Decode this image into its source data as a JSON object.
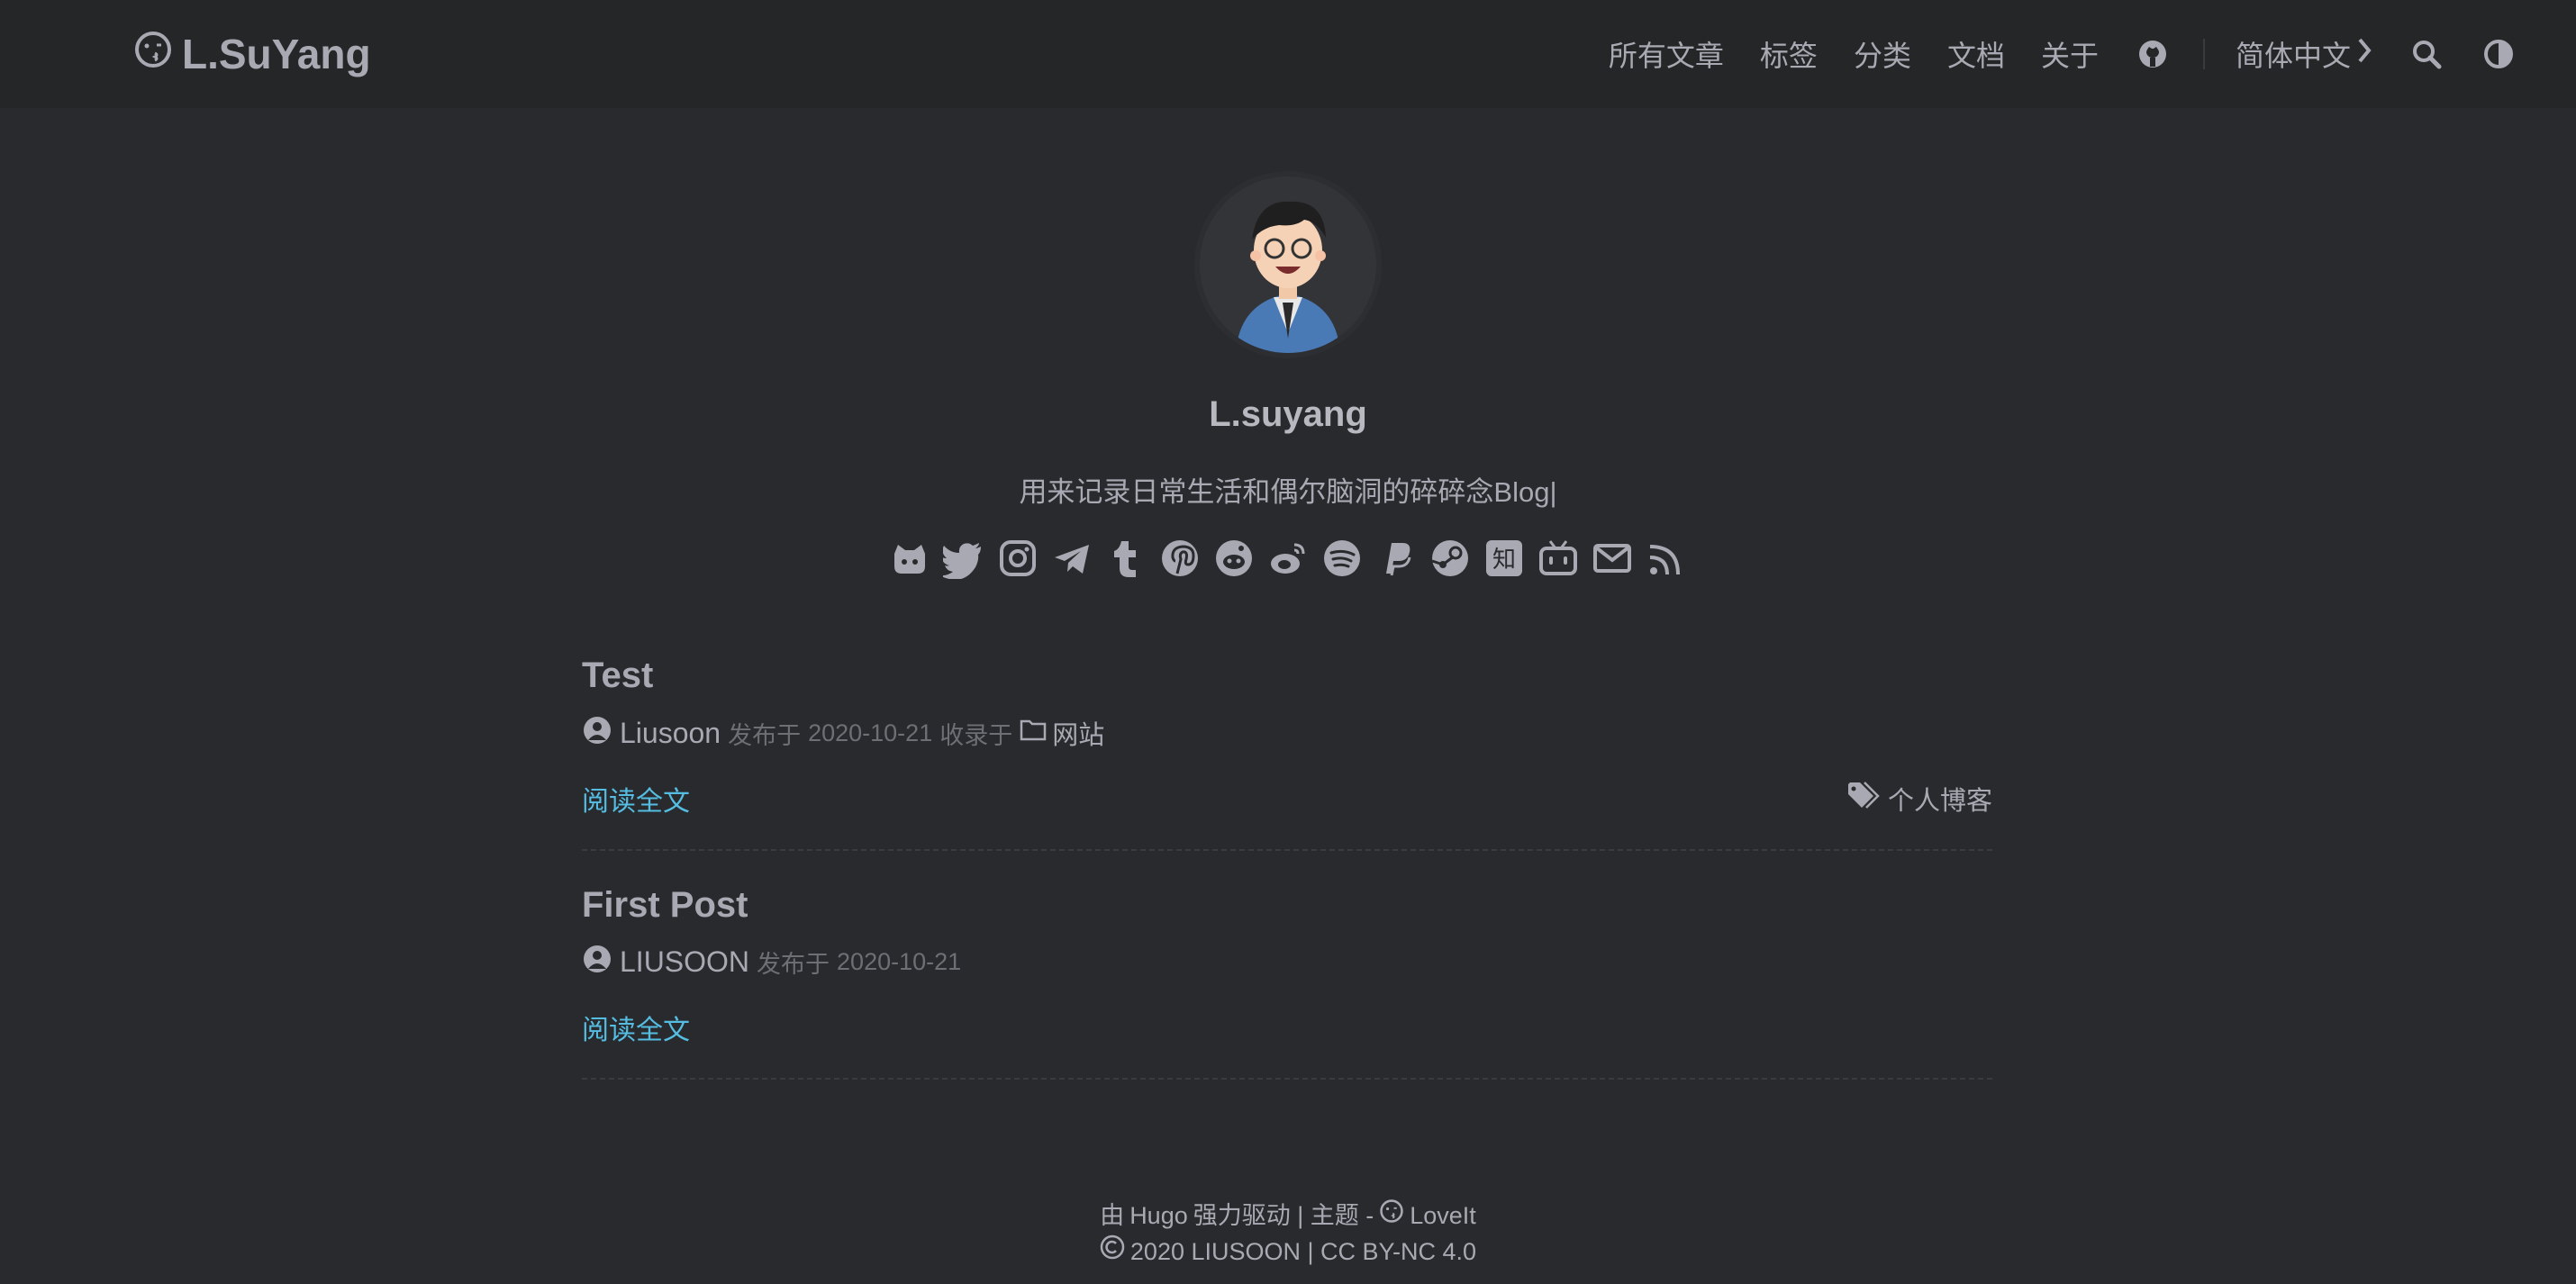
{
  "header": {
    "logo_text": "L.SuYang",
    "nav": [
      "所有文章",
      "标签",
      "分类",
      "文档",
      "关于"
    ],
    "language": "简体中文"
  },
  "profile": {
    "name": "L.suyang",
    "subtitle": "用来记录日常生活和偶尔脑洞的碎碎念Blog|",
    "socials": [
      "github-icon",
      "twitter-icon",
      "instagram-icon",
      "telegram-icon",
      "tumblr-icon",
      "pinterest-icon",
      "reddit-icon",
      "weibo-icon",
      "spotify-icon",
      "paypal-icon",
      "steam-icon",
      "zhihu-icon",
      "bilibili-icon",
      "email-icon",
      "rss-icon"
    ]
  },
  "posts": [
    {
      "title": "Test",
      "author": "Liusoon",
      "published_label": "发布于",
      "date": "2020-10-21",
      "category_label": "收录于",
      "category": "网站",
      "read_more": "阅读全文",
      "tag": "个人博客"
    },
    {
      "title": "First Post",
      "author": "LIUSOON",
      "published_label": "发布于",
      "date": "2020-10-21",
      "read_more": "阅读全文"
    }
  ],
  "footer": {
    "by": "由",
    "hugo": "Hugo",
    "powered": "强力驱动 | 主题 -",
    "theme": "LoveIt",
    "copyright": "2020 LIUSOON | CC BY-NC 4.0"
  },
  "colors": {
    "background": "#292a2d",
    "header": "#252627",
    "text": "#a9a9b3",
    "link": "#55bde2"
  }
}
